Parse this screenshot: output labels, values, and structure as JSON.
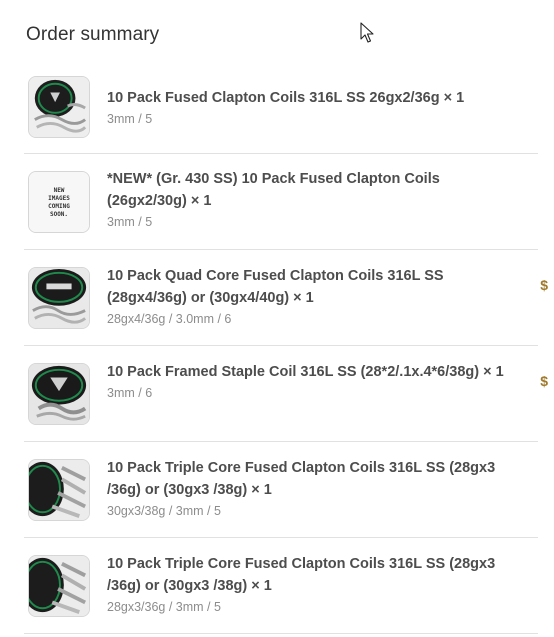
{
  "heading": "Order summary",
  "items": [
    {
      "title": "10 Pack Fused Clapton Coils 316L SS 26gx2/36g",
      "qty": "× 1",
      "variant": "3mm / 5",
      "image": "coil-tin-image",
      "price_peek": ""
    },
    {
      "title": "*NEW* (Gr. 430 SS) 10 Pack Fused Clapton Coils (26gx2/30g)",
      "qty": "× 1",
      "variant": "3mm / 5",
      "image": "placeholder-image",
      "placeholder_text": [
        "NEW",
        "IMAGES",
        "COMING",
        "SOON."
      ],
      "price_peek": ""
    },
    {
      "title": "10 Pack Quad Core Fused Clapton Coils 316L SS (28gx4/36g) or (30gx4/40g)",
      "qty": "× 1",
      "variant": "28gx4/36g / 3.0mm / 6",
      "image": "coil-tin-image",
      "price_peek": "$"
    },
    {
      "title": "10 Pack Framed Staple Coil 316L SS (28*2/.1x.4*6/38g)",
      "qty": "× 1",
      "variant": "3mm / 6",
      "image": "coil-tin-image",
      "price_peek": "$"
    },
    {
      "title": "10 Pack Triple Core Fused Clapton Coils 316L SS (28gx3 /36g) or (30gx3 /38g)",
      "qty": "× 1",
      "variant": "30gx3/38g / 3mm / 5",
      "image": "coil-tin-image",
      "price_peek": ""
    },
    {
      "title": "10 Pack Triple Core Fused Clapton Coils 316L SS (28gx3 /36g) or (30gx3 /38g)",
      "qty": "× 1",
      "variant": "28gx3/36g / 3mm / 5",
      "image": "coil-tin-image",
      "price_peek": ""
    }
  ],
  "colors": {
    "title": "#4d4d4d",
    "variant": "#8c8c8c",
    "divider": "#e1e1e1",
    "tin_green": "#1f8a4c"
  }
}
